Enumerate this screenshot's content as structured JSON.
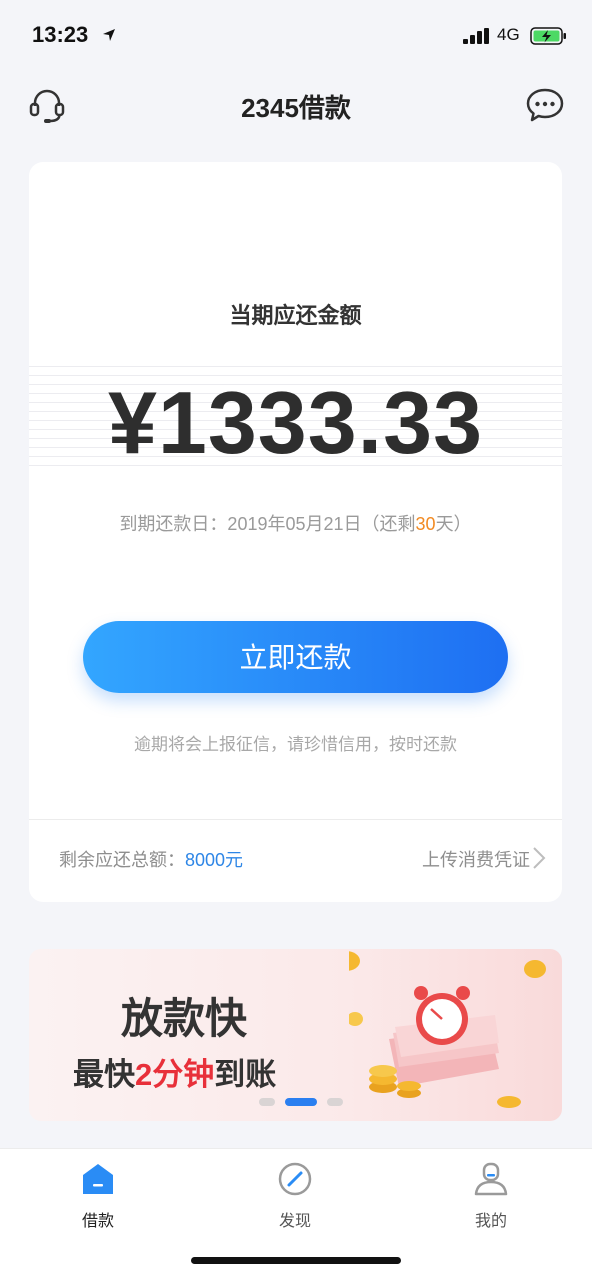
{
  "status_bar": {
    "time": "13:23",
    "network": "4G"
  },
  "header": {
    "title": "2345借款"
  },
  "repayment": {
    "label": "当期应还金额",
    "amount": "¥1333.33",
    "due_prefix": "到期还款日：2019年05月21日（还剩",
    "days_left": "30",
    "due_suffix": "天）",
    "pay_button": "立即还款",
    "warning": "逾期将会上报征信，请珍惜信用，按时还款",
    "remaining_label": "剩余应还总额：",
    "remaining_value": "8000元",
    "upload_label": "上传消费凭证"
  },
  "banner": {
    "title": "放款快",
    "sub_prefix": "最快",
    "sub_highlight": "2分钟",
    "sub_suffix": "到账",
    "carousel_total": 3,
    "carousel_active": 2
  },
  "tabbar": {
    "tabs": [
      {
        "label": "借款",
        "active": true
      },
      {
        "label": "发现",
        "active": false
      },
      {
        "label": "我的",
        "active": false
      }
    ]
  },
  "colors": {
    "accent": "#2a8cf5",
    "highlight_orange": "#f28a22",
    "highlight_red": "#e8303a"
  }
}
